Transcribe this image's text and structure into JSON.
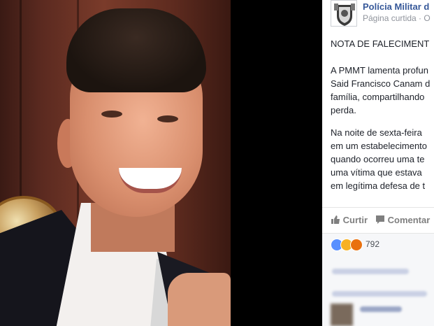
{
  "post": {
    "page_name": "Polícia Militar d",
    "page_sub": "Página curtida · O",
    "lines": [
      "NOTA DE FALECIMENT",
      "",
      "A PMMT lamenta profun",
      "Said Francisco Canam d",
      "família, compartilhando",
      "perda.",
      "",
      "Na noite de sexta-feira",
      "em um estabelecimento",
      "quando ocorreu uma te",
      "uma vítima que estava",
      "em legítima defesa de t"
    ],
    "actions": {
      "like": "Curtir",
      "comment": "Comentar"
    },
    "reaction_count": "792"
  },
  "colors": {
    "link": "#365899",
    "like_blue": "#5890ff",
    "sad_yellow": "#f7b125",
    "angry_red": "#e9710f"
  },
  "icons": [
    "page-avatar-emblem-icon",
    "like-icon",
    "comment-icon",
    "like-reaction-icon",
    "sad-reaction-icon",
    "angry-reaction-icon"
  ]
}
